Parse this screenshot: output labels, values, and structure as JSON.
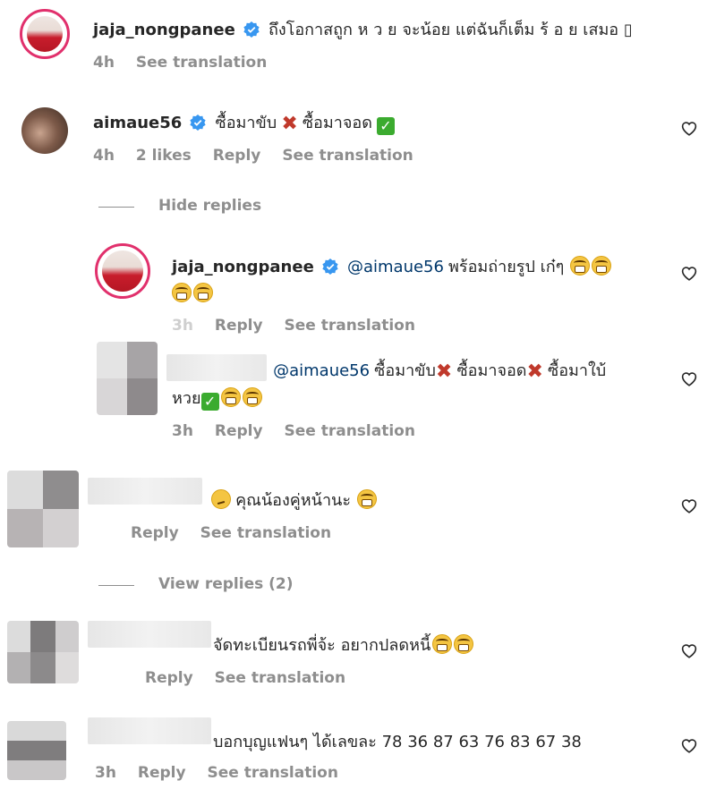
{
  "comments": [
    {
      "username": "jaja_nongpanee",
      "verified": true,
      "text": "ถึงโอกาสถูก ห ว ย จะน้อย แต่ฉันก็เต็ม ร้ อ ย เสมอ ▯",
      "time": "4h",
      "see_translation": "See translation"
    },
    {
      "username": "aimaue56",
      "verified": true,
      "text_part1": "ซื้อมาขับ",
      "text_part2": "ซื้อมาจอด",
      "time": "4h",
      "likes": "2 likes",
      "reply": "Reply",
      "see_translation": "See translation",
      "hide_replies": "Hide replies"
    },
    {
      "username": "jaja_nongpanee",
      "verified": true,
      "mention": "@aimaue56",
      "text": "พร้อมถ่ายรูป เก๋ๆ",
      "time": "3h",
      "reply": "Reply",
      "see_translation": "See translation"
    },
    {
      "mention": "@aimaue56",
      "text_part1": "ซื้อมาขับ",
      "text_part2": "ซื้อมาจอด",
      "text_part3": "ซื้อมาใบ้",
      "text_part4": "หวย",
      "time": "3h",
      "reply": "Reply",
      "see_translation": "See translation"
    },
    {
      "text": "คุณน้องคู่หน้านะ",
      "reply": "Reply",
      "see_translation": "See translation",
      "view_replies": "View replies (2)"
    },
    {
      "text": "จัดทะเบียนรถพี่จ้ะ อยากปลดหนี้",
      "reply": "Reply",
      "see_translation": "See translation"
    },
    {
      "text": "บอกบุญแฟนๆ ได้เลขละ 78 36 87 63 76 83 67 38",
      "time": "3h",
      "reply": "Reply",
      "see_translation": "See translation"
    }
  ],
  "colors": {
    "text": "#262626",
    "secondary": "#8e8e8e",
    "mention": "#00376b",
    "verified": "#3897f0",
    "story_ring": "#e1306c"
  },
  "icons": [
    "verified-badge-icon",
    "heart-icon",
    "cross-mark-emoji",
    "check-mark-emoji",
    "grinning-sweat-emoji",
    "thinking-emoji"
  ]
}
